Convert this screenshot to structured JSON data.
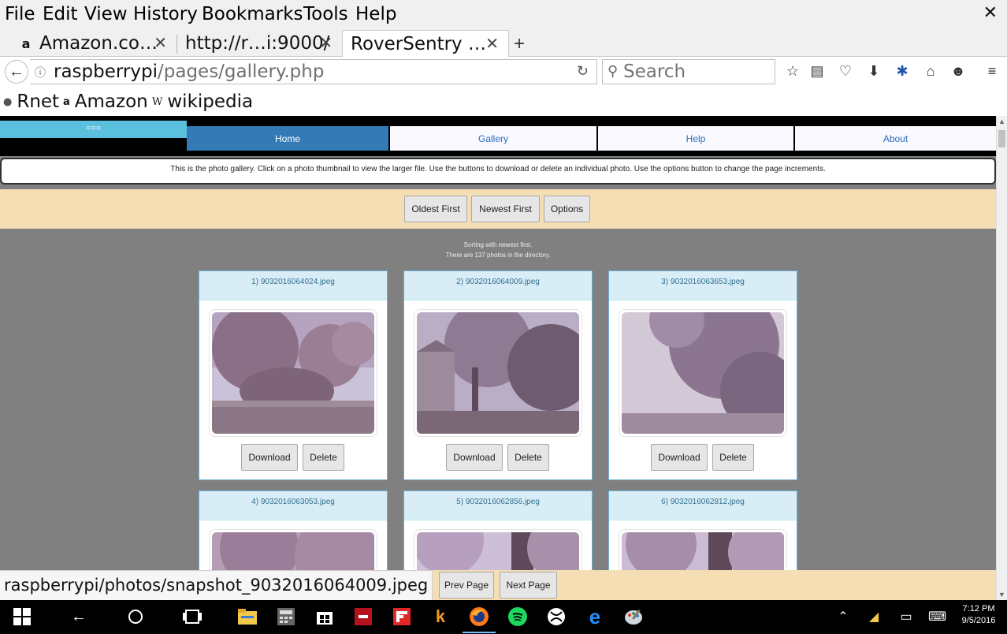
{
  "menubar": {
    "items": [
      "File",
      "Edit",
      "View",
      "History",
      "Bookmarks",
      "Tools",
      "Help"
    ],
    "close": "✕"
  },
  "tabs": [
    {
      "label": "Amazon.co…",
      "favicon": "a",
      "active": false
    },
    {
      "label": "http://r…i:9000/",
      "favicon": "",
      "active": false
    },
    {
      "label": "RoverSentry …",
      "favicon": "",
      "active": true
    }
  ],
  "new_tab": "+",
  "navbar": {
    "url_host": "raspberrypi",
    "url_path": "/pages/gallery.php",
    "search_placeholder": "Search"
  },
  "bookmarks": [
    {
      "label": "Rnet",
      "icon": "globe-icon"
    },
    {
      "label": "Amazon",
      "icon": "amazon-icon"
    },
    {
      "label": "wikipedia",
      "icon": "wikipedia-icon"
    }
  ],
  "site": {
    "menu_toggle": "===",
    "nav": [
      "Home",
      "Gallery",
      "Help",
      "About"
    ],
    "active_nav": "Home",
    "info": "This is the photo gallery. Click on a photo thumbnail to view the larger file. Use the buttons to download or delete an individual photo. Use the options button to change the page increments.",
    "sort_buttons": [
      "Oldest First",
      "Newest First",
      "Options"
    ],
    "status_line1": "Sorting with newest first.",
    "status_line2": "There are 137 photos in the directory.",
    "photos": [
      {
        "title": "1) 9032016064024.jpeg"
      },
      {
        "title": "2) 9032016064009.jpeg"
      },
      {
        "title": "3) 9032016063653.jpeg"
      },
      {
        "title": "4) 9032016063053.jpeg"
      },
      {
        "title": "5) 9032016062856.jpeg"
      },
      {
        "title": "6) 9032016062812.jpeg"
      }
    ],
    "download_label": "Download",
    "delete_label": "Delete",
    "prev_page": "Prev Page",
    "next_page": "Next Page"
  },
  "status_url": "raspberrypi/photos/snapshot_9032016064009.jpeg",
  "taskbar": {
    "time": "7:12 PM",
    "date": "9/5/2016"
  },
  "colors": {
    "accent": "#337ab7",
    "toggle": "#5bc0de",
    "band": "#f5deb3",
    "page_bg": "#808080"
  }
}
